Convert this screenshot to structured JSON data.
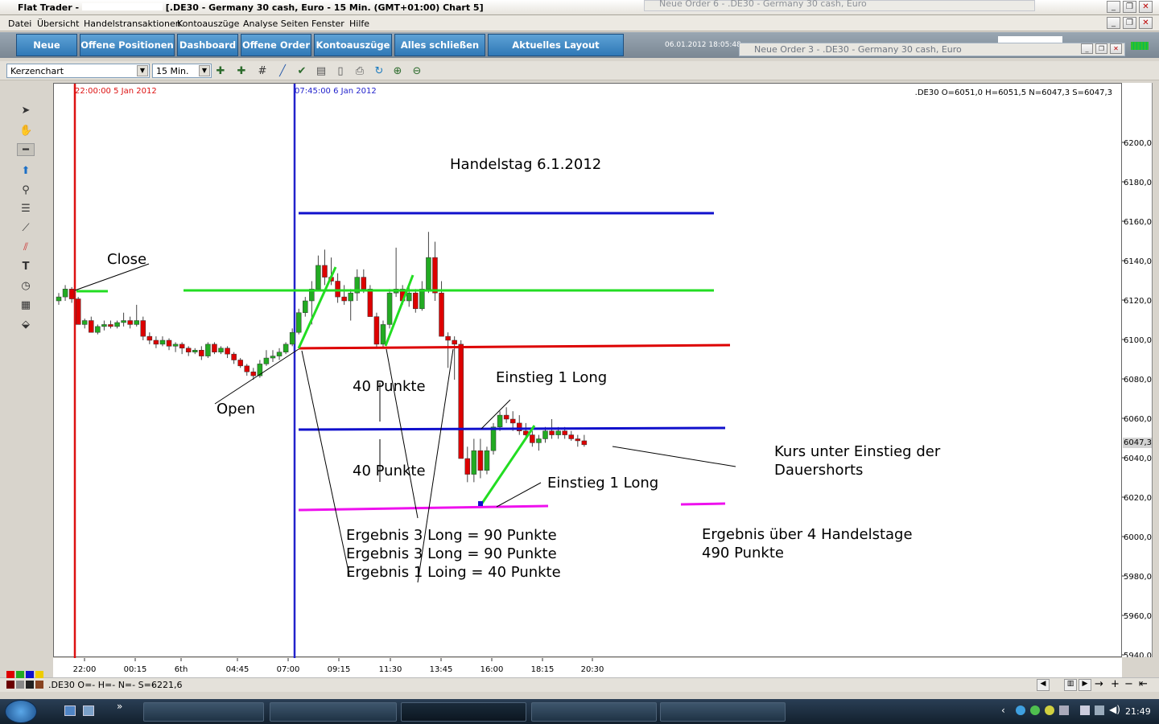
{
  "window": {
    "title": "Flat Trader - ",
    "chart_title": "[.DE30 - Germany 30 cash, Euro - 15 Min. (GMT+01:00)   Chart 5]",
    "background_popup_title": "Neue Order 6 - .DE30 - Germany 30 cash, Euro",
    "popup_title": "Neue Order 3 - .DE30 - Germany 30 cash, Euro"
  },
  "menu": [
    "Datei",
    "Übersicht",
    "Handelstransaktionen",
    "Kontoauszüge",
    "Analyse Seiten",
    "Fenster",
    "Hilfe"
  ],
  "toolbar": {
    "buttons": [
      "Neue Order",
      "Offene Positionen",
      "Dashboard",
      "Offene Order",
      "Kontoauszüge",
      "Alles schließen",
      "Aktuelles Layout speichern"
    ],
    "datetime": "06.01.2012 18:05:48"
  },
  "chart_controls": {
    "chart_type": "Kerzenchart",
    "interval": "15 Min.",
    "icons": [
      "add-indicator-icon",
      "add-study-icon",
      "grid-icon",
      "draw-line-icon",
      "check-icon",
      "document-icon",
      "page-icon",
      "print-icon",
      "refresh-icon",
      "zoom-in-icon",
      "zoom-out-icon"
    ]
  },
  "drawing_tools": [
    "cursor-icon",
    "hand-icon",
    "horizontal-line-icon",
    "arrow-up-icon",
    "zoom-icon",
    "fibonacci-icon",
    "trendline-icon",
    "channel-icon",
    "text-icon",
    "clock-icon",
    "calculator-icon",
    "paint-icon"
  ],
  "chart": {
    "ohlc_readout": ".DE30 O=6051,0 H=6051,5 N=6047,3 S=6047,3",
    "marker_red_label": "22:00:00 5 Jan 2012",
    "marker_blue_label": "07:45:00 6 Jan 2012",
    "current_price_label": "6047,3",
    "colors": {
      "bull": "#22aa22",
      "bear": "#dd0000",
      "marker_red": "#dd1111",
      "marker_blue": "#2222cc"
    }
  },
  "annotations": {
    "headline": "Handelstag 6.1.2012",
    "close": "Close",
    "open": "Open",
    "punkte_1": "40 Punkte",
    "punkte_2": "40 Punkte",
    "einstieg_upper": "Einstieg 1 Long",
    "einstieg_lower": "Einstieg 1 Long",
    "kurs_line1": "Kurs unter Einstieg der",
    "kurs_line2": "Dauershorts",
    "ergebnis_1": "Ergebnis 3 Long = 90 Punkte",
    "ergebnis_2": "Ergebnis 3 Long = 90 Punkte",
    "ergebnis_3": "Ergebnis 1 Loing = 40 Punkte",
    "ergebnis_total_1": "Ergebnis über 4 Handelstage",
    "ergebnis_total_2": "490 Punkte"
  },
  "chart_data": {
    "type": "candlestick",
    "y_ticks": [
      "6200,0",
      "6180,0",
      "6160,0",
      "6140,0",
      "6120,0",
      "6100,0",
      "6080,0",
      "6060,0",
      "6040,0",
      "6020,0",
      "6000,0",
      "5980,0",
      "5960,0",
      "5940,0"
    ],
    "ylim": [
      5940,
      6200
    ],
    "x_ticks": [
      "22:00",
      "00:15",
      "6th",
      "04:45",
      "07:00",
      "09:15",
      "11:30",
      "13:45",
      "16:00",
      "18:15",
      "20:30"
    ],
    "candles": [
      [
        6120,
        6124,
        6118,
        6122
      ],
      [
        6122,
        6128,
        6120,
        6126
      ],
      [
        6126,
        6127,
        6119,
        6121
      ],
      [
        6121,
        6122,
        6108,
        6108
      ],
      [
        6108,
        6111,
        6106,
        6110
      ],
      [
        6110,
        6112,
        6104,
        6104
      ],
      [
        6104,
        6108,
        6103,
        6107
      ],
      [
        6107,
        6110,
        6105,
        6108
      ],
      [
        6108,
        6110,
        6106,
        6107
      ],
      [
        6107,
        6110,
        6106,
        6109
      ],
      [
        6109,
        6114,
        6107,
        6110
      ],
      [
        6110,
        6112,
        6106,
        6108
      ],
      [
        6108,
        6118,
        6107,
        6110
      ],
      [
        6110,
        6112,
        6100,
        6102
      ],
      [
        6102,
        6104,
        6098,
        6100
      ],
      [
        6100,
        6102,
        6096,
        6098
      ],
      [
        6098,
        6102,
        6097,
        6100
      ],
      [
        6100,
        6101,
        6095,
        6097
      ],
      [
        6097,
        6099,
        6094,
        6098
      ],
      [
        6098,
        6099,
        6093,
        6096
      ],
      [
        6096,
        6097,
        6092,
        6094
      ],
      [
        6094,
        6096,
        6093,
        6095
      ],
      [
        6095,
        6097,
        6090,
        6092
      ],
      [
        6092,
        6099,
        6091,
        6098
      ],
      [
        6098,
        6099,
        6093,
        6094
      ],
      [
        6094,
        6097,
        6093,
        6096
      ],
      [
        6096,
        6097,
        6091,
        6093
      ],
      [
        6093,
        6094,
        6088,
        6090
      ],
      [
        6090,
        6091,
        6086,
        6087
      ],
      [
        6087,
        6088,
        6082,
        6084
      ],
      [
        6084,
        6086,
        6080,
        6082
      ],
      [
        6082,
        6090,
        6081,
        6088
      ],
      [
        6088,
        6095,
        6087,
        6091
      ],
      [
        6091,
        6095,
        6089,
        6092
      ],
      [
        6092,
        6096,
        6090,
        6094
      ],
      [
        6094,
        6099,
        6093,
        6098
      ],
      [
        6098,
        6106,
        6097,
        6104
      ],
      [
        6104,
        6116,
        6103,
        6114
      ],
      [
        6114,
        6122,
        6112,
        6120
      ],
      [
        6120,
        6130,
        6108,
        6126
      ],
      [
        6126,
        6143,
        6125,
        6138
      ],
      [
        6138,
        6146,
        6128,
        6132
      ],
      [
        6132,
        6142,
        6128,
        6130
      ],
      [
        6130,
        6134,
        6119,
        6122
      ],
      [
        6122,
        6128,
        6118,
        6120
      ],
      [
        6120,
        6126,
        6110,
        6124
      ],
      [
        6124,
        6136,
        6120,
        6132
      ],
      [
        6132,
        6136,
        6124,
        6126
      ],
      [
        6126,
        6128,
        6112,
        6112
      ],
      [
        6112,
        6114,
        6096,
        6098
      ],
      [
        6098,
        6110,
        6096,
        6108
      ],
      [
        6108,
        6126,
        6106,
        6124
      ],
      [
        6124,
        6147,
        6122,
        6126
      ],
      [
        6126,
        6128,
        6118,
        6120
      ],
      [
        6120,
        6128,
        6117,
        6124
      ],
      [
        6124,
        6126,
        6114,
        6116
      ],
      [
        6116,
        6130,
        6115,
        6126
      ],
      [
        6126,
        6155,
        6124,
        6142
      ],
      [
        6142,
        6150,
        6120,
        6124
      ],
      [
        6124,
        6130,
        6102,
        6102
      ],
      [
        6102,
        6104,
        6086,
        6100
      ],
      [
        6100,
        6102,
        6080,
        6098
      ],
      [
        6098,
        6100,
        6061,
        6040
      ],
      [
        6040,
        6046,
        6028,
        6032
      ],
      [
        6032,
        6050,
        6028,
        6044
      ],
      [
        6044,
        6050,
        6030,
        6034
      ],
      [
        6034,
        6046,
        6032,
        6044
      ],
      [
        6044,
        6058,
        6042,
        6056
      ],
      [
        6056,
        6064,
        6054,
        6062
      ],
      [
        6062,
        6066,
        6058,
        6060
      ],
      [
        6060,
        6064,
        6054,
        6058
      ],
      [
        6058,
        6062,
        6052,
        6054
      ],
      [
        6054,
        6058,
        6050,
        6052
      ],
      [
        6052,
        6054,
        6046,
        6048
      ],
      [
        6048,
        6052,
        6044,
        6050
      ],
      [
        6050,
        6056,
        6048,
        6054
      ],
      [
        6054,
        6060,
        6050,
        6052
      ],
      [
        6052,
        6056,
        6050,
        6054
      ],
      [
        6054,
        6056,
        6050,
        6052
      ],
      [
        6052,
        6054,
        6049,
        6050
      ],
      [
        6050,
        6052,
        6046,
        6049
      ],
      [
        6049,
        6052,
        6046,
        6047
      ]
    ]
  },
  "statusbar": {
    "text": ".DE30 O=- H=- N=- S=-",
    "value": "6221,6"
  },
  "taskbar": {
    "clock": "21:49"
  }
}
